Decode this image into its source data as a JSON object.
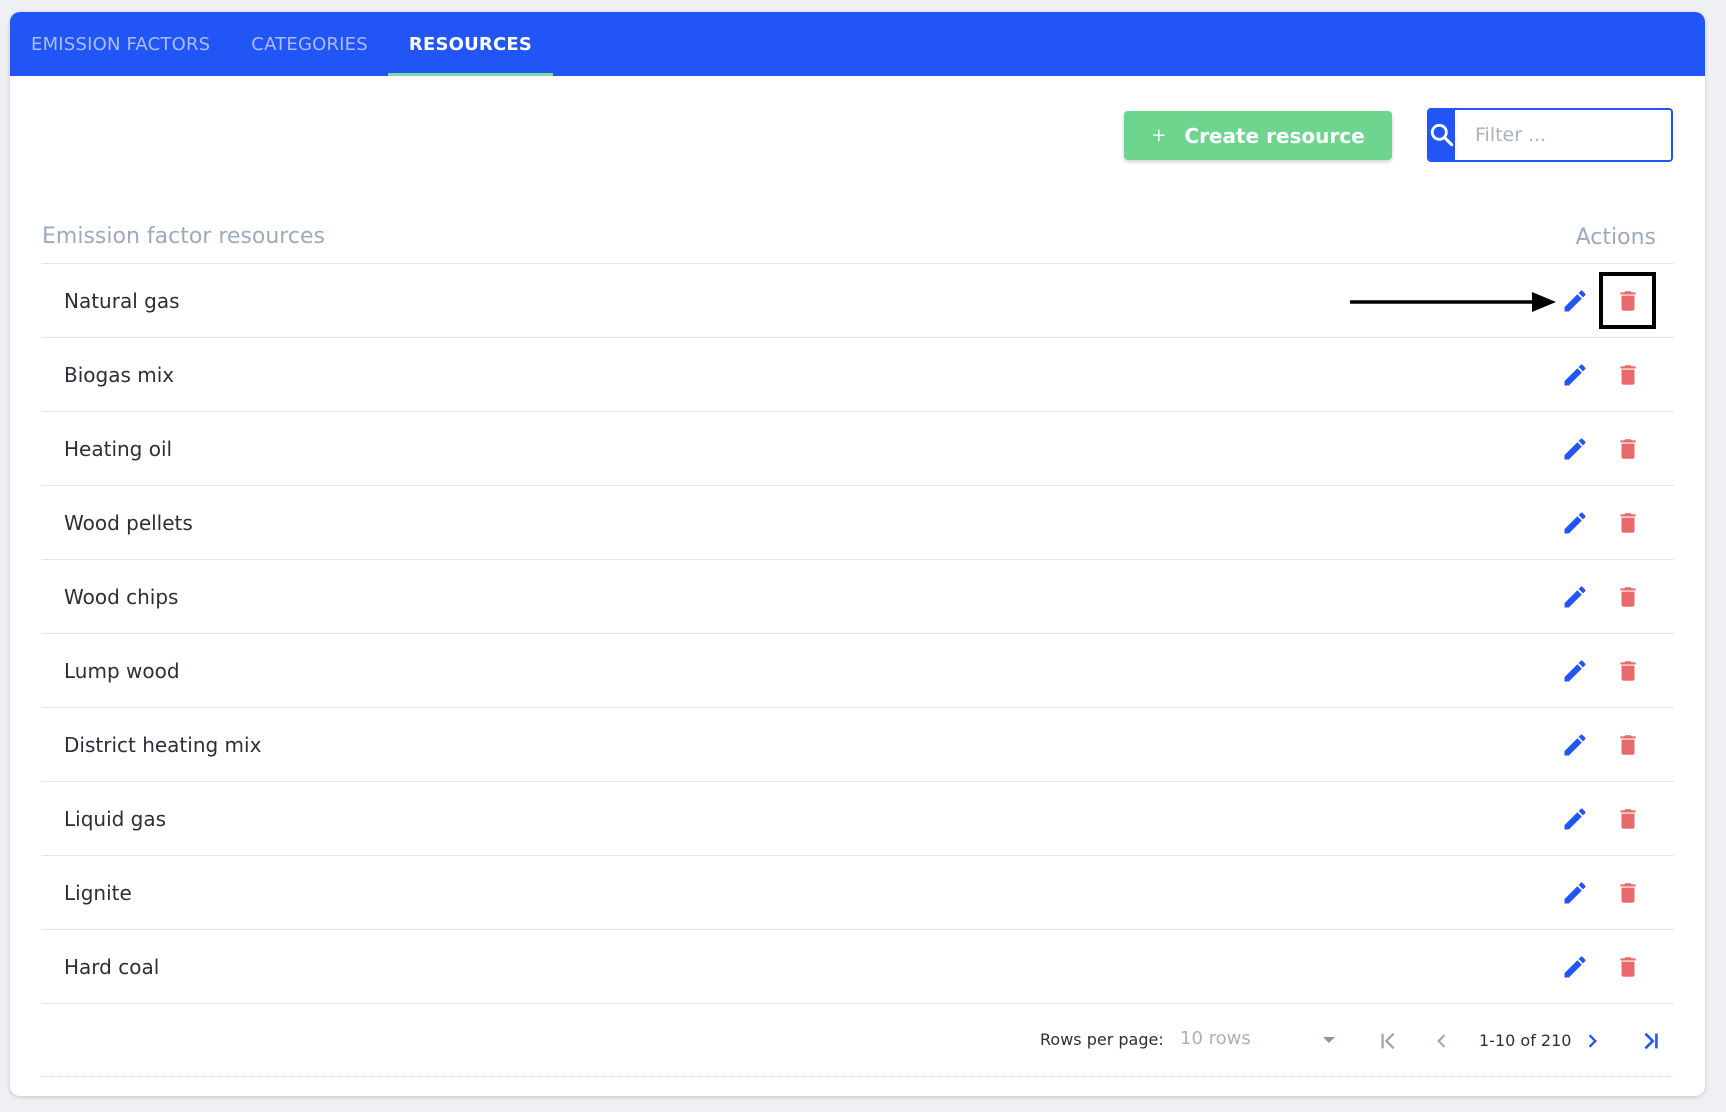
{
  "tabs": [
    {
      "label": "EMISSION FACTORS",
      "active": false
    },
    {
      "label": "CATEGORIES",
      "active": false
    },
    {
      "label": "RESOURCES",
      "active": true
    }
  ],
  "toolbar": {
    "create_label": "Create resource",
    "create_icon": "plus-icon",
    "filter_placeholder": "Filter ...",
    "filter_value": "",
    "search_icon": "search-icon"
  },
  "table": {
    "name_header": "Emission factor resources",
    "actions_header": "Actions",
    "rows": [
      {
        "name": "Natural gas"
      },
      {
        "name": "Biogas mix"
      },
      {
        "name": "Heating oil"
      },
      {
        "name": "Wood pellets"
      },
      {
        "name": "Wood chips"
      },
      {
        "name": "Lump wood"
      },
      {
        "name": "District heating mix"
      },
      {
        "name": "Liquid gas"
      },
      {
        "name": "Lignite"
      },
      {
        "name": "Hard coal"
      }
    ]
  },
  "pagination": {
    "rows_per_page_label": "Rows per page:",
    "rows_per_page_value": "10 rows",
    "range": "1-10 of 210"
  },
  "colors": {
    "primary": "#2155f6",
    "create_button": "#6ed58f",
    "tab_indicator": "#7adc9f",
    "edit_icon": "#2155f6",
    "delete_icon": "#e96a6a"
  }
}
